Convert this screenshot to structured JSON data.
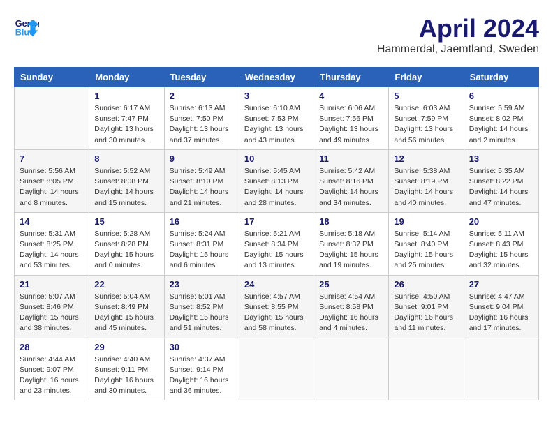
{
  "header": {
    "logo_line1": "General",
    "logo_line2": "Blue",
    "month": "April 2024",
    "location": "Hammerdal, Jaemtland, Sweden"
  },
  "days_of_week": [
    "Sunday",
    "Monday",
    "Tuesday",
    "Wednesday",
    "Thursday",
    "Friday",
    "Saturday"
  ],
  "weeks": [
    [
      {
        "day": "",
        "info": ""
      },
      {
        "day": "1",
        "info": "Sunrise: 6:17 AM\nSunset: 7:47 PM\nDaylight: 13 hours\nand 30 minutes."
      },
      {
        "day": "2",
        "info": "Sunrise: 6:13 AM\nSunset: 7:50 PM\nDaylight: 13 hours\nand 37 minutes."
      },
      {
        "day": "3",
        "info": "Sunrise: 6:10 AM\nSunset: 7:53 PM\nDaylight: 13 hours\nand 43 minutes."
      },
      {
        "day": "4",
        "info": "Sunrise: 6:06 AM\nSunset: 7:56 PM\nDaylight: 13 hours\nand 49 minutes."
      },
      {
        "day": "5",
        "info": "Sunrise: 6:03 AM\nSunset: 7:59 PM\nDaylight: 13 hours\nand 56 minutes."
      },
      {
        "day": "6",
        "info": "Sunrise: 5:59 AM\nSunset: 8:02 PM\nDaylight: 14 hours\nand 2 minutes."
      }
    ],
    [
      {
        "day": "7",
        "info": "Sunrise: 5:56 AM\nSunset: 8:05 PM\nDaylight: 14 hours\nand 8 minutes."
      },
      {
        "day": "8",
        "info": "Sunrise: 5:52 AM\nSunset: 8:08 PM\nDaylight: 14 hours\nand 15 minutes."
      },
      {
        "day": "9",
        "info": "Sunrise: 5:49 AM\nSunset: 8:10 PM\nDaylight: 14 hours\nand 21 minutes."
      },
      {
        "day": "10",
        "info": "Sunrise: 5:45 AM\nSunset: 8:13 PM\nDaylight: 14 hours\nand 28 minutes."
      },
      {
        "day": "11",
        "info": "Sunrise: 5:42 AM\nSunset: 8:16 PM\nDaylight: 14 hours\nand 34 minutes."
      },
      {
        "day": "12",
        "info": "Sunrise: 5:38 AM\nSunset: 8:19 PM\nDaylight: 14 hours\nand 40 minutes."
      },
      {
        "day": "13",
        "info": "Sunrise: 5:35 AM\nSunset: 8:22 PM\nDaylight: 14 hours\nand 47 minutes."
      }
    ],
    [
      {
        "day": "14",
        "info": "Sunrise: 5:31 AM\nSunset: 8:25 PM\nDaylight: 14 hours\nand 53 minutes."
      },
      {
        "day": "15",
        "info": "Sunrise: 5:28 AM\nSunset: 8:28 PM\nDaylight: 15 hours\nand 0 minutes."
      },
      {
        "day": "16",
        "info": "Sunrise: 5:24 AM\nSunset: 8:31 PM\nDaylight: 15 hours\nand 6 minutes."
      },
      {
        "day": "17",
        "info": "Sunrise: 5:21 AM\nSunset: 8:34 PM\nDaylight: 15 hours\nand 13 minutes."
      },
      {
        "day": "18",
        "info": "Sunrise: 5:18 AM\nSunset: 8:37 PM\nDaylight: 15 hours\nand 19 minutes."
      },
      {
        "day": "19",
        "info": "Sunrise: 5:14 AM\nSunset: 8:40 PM\nDaylight: 15 hours\nand 25 minutes."
      },
      {
        "day": "20",
        "info": "Sunrise: 5:11 AM\nSunset: 8:43 PM\nDaylight: 15 hours\nand 32 minutes."
      }
    ],
    [
      {
        "day": "21",
        "info": "Sunrise: 5:07 AM\nSunset: 8:46 PM\nDaylight: 15 hours\nand 38 minutes."
      },
      {
        "day": "22",
        "info": "Sunrise: 5:04 AM\nSunset: 8:49 PM\nDaylight: 15 hours\nand 45 minutes."
      },
      {
        "day": "23",
        "info": "Sunrise: 5:01 AM\nSunset: 8:52 PM\nDaylight: 15 hours\nand 51 minutes."
      },
      {
        "day": "24",
        "info": "Sunrise: 4:57 AM\nSunset: 8:55 PM\nDaylight: 15 hours\nand 58 minutes."
      },
      {
        "day": "25",
        "info": "Sunrise: 4:54 AM\nSunset: 8:58 PM\nDaylight: 16 hours\nand 4 minutes."
      },
      {
        "day": "26",
        "info": "Sunrise: 4:50 AM\nSunset: 9:01 PM\nDaylight: 16 hours\nand 11 minutes."
      },
      {
        "day": "27",
        "info": "Sunrise: 4:47 AM\nSunset: 9:04 PM\nDaylight: 16 hours\nand 17 minutes."
      }
    ],
    [
      {
        "day": "28",
        "info": "Sunrise: 4:44 AM\nSunset: 9:07 PM\nDaylight: 16 hours\nand 23 minutes."
      },
      {
        "day": "29",
        "info": "Sunrise: 4:40 AM\nSunset: 9:11 PM\nDaylight: 16 hours\nand 30 minutes."
      },
      {
        "day": "30",
        "info": "Sunrise: 4:37 AM\nSunset: 9:14 PM\nDaylight: 16 hours\nand 36 minutes."
      },
      {
        "day": "",
        "info": ""
      },
      {
        "day": "",
        "info": ""
      },
      {
        "day": "",
        "info": ""
      },
      {
        "day": "",
        "info": ""
      }
    ]
  ]
}
